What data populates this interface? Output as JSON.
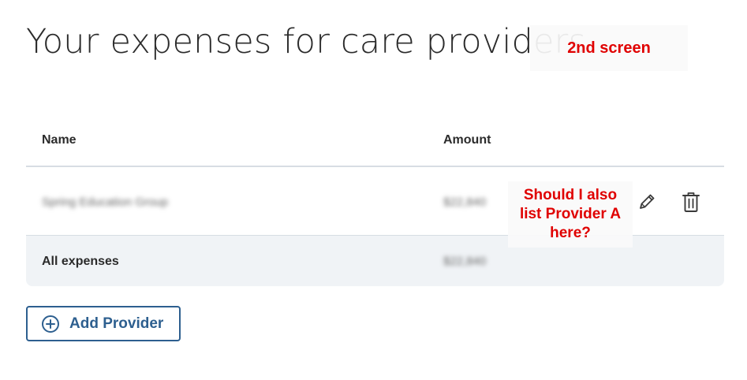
{
  "page": {
    "title": "Your expenses for care providers"
  },
  "annotations": {
    "screen_note": "2nd screen",
    "question_line1": "Should I also",
    "question_line2": "list Provider A",
    "question_line3": "here?"
  },
  "table": {
    "columns": [
      "Name",
      "Amount"
    ],
    "rows": [
      {
        "name": "Spring Education Group",
        "amount": "$22,840"
      }
    ],
    "total": {
      "label": "All expenses",
      "amount": "$22,840"
    }
  },
  "actions": {
    "add_provider_label": "Add Provider"
  },
  "colors": {
    "accent": "#2d5f8f",
    "annotation": "#e00000",
    "total_row_bg": "#f0f3f6",
    "divider": "#d7dde3"
  },
  "icons": {
    "edit": "pencil-icon",
    "delete": "trash-icon",
    "add": "plus-circle-icon"
  }
}
